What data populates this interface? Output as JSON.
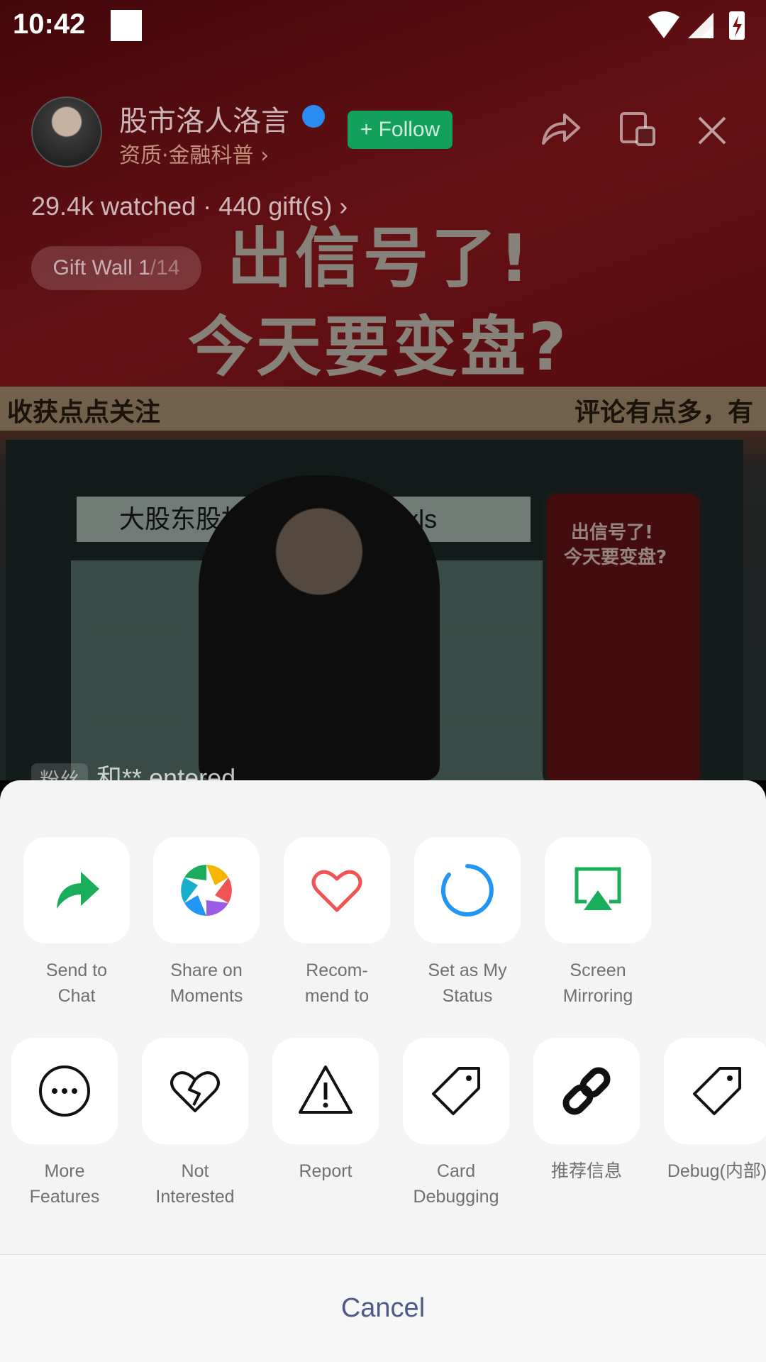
{
  "status_bar": {
    "time": "10:42"
  },
  "stream": {
    "streamer_name": "股市洛人洛言",
    "sub_label": "资质·金融科普 ›",
    "follow_label": "+ Follow",
    "watched": "29.4k watched · 440 gift(s) ›",
    "gift_wall": "Gift Wall 1",
    "gift_wall_count": "/14",
    "promo_line1": "出信号了!",
    "promo_line2": "今天要变盘?",
    "ticker_left": "收获点点关注",
    "ticker_right": "评论有点多，有",
    "file_label": "大股东股权...2024-07-05.xls",
    "phone_line1": "出信号了!",
    "phone_line2": "今天要变盘?",
    "entered_badge": "粉丝",
    "entered_text": "和** entered"
  },
  "share_sheet": {
    "row1": [
      {
        "label": "Send to\nChat",
        "icon": "share-arrow-icon",
        "color": "#1aad5b"
      },
      {
        "label": "Share on\nMoments",
        "icon": "moments-aperture-icon"
      },
      {
        "label": "Recom-\nmend to",
        "icon": "heart-icon",
        "color": "#f05454"
      },
      {
        "label": "Set as My\nStatus",
        "icon": "status-ring-icon",
        "color": "#2196f3"
      },
      {
        "label": "Screen\nMirroring",
        "icon": "airplay-icon",
        "color": "#1aad5b"
      }
    ],
    "row2": [
      {
        "label": "More\nFeatures",
        "icon": "more-dots-icon"
      },
      {
        "label": "Not\nInterested",
        "icon": "broken-heart-icon"
      },
      {
        "label": "Report",
        "icon": "warning-icon"
      },
      {
        "label": "Card\nDebugging",
        "icon": "tag-icon"
      },
      {
        "label": "推荐信息",
        "icon": "link-icon"
      },
      {
        "label": "Debug(内部)",
        "icon": "tag-icon"
      }
    ],
    "cancel_label": "Cancel"
  }
}
